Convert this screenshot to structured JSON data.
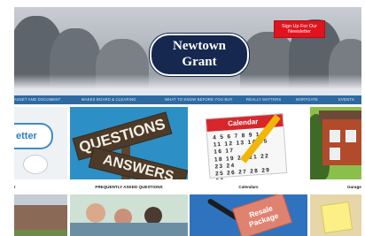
{
  "header": {
    "logo_line1": "Newtown",
    "logo_line2": "Grant",
    "signup_label": "Sign Up For Our Newsletter"
  },
  "nav": {
    "items": [
      "ASSET AND DOCUMENT",
      "MAKES BOARD & CLEARING",
      "WHAT TO KNOW BEFORE YOU BUY",
      "REALLY MATTERS",
      "MORTGATE",
      "EVENTS"
    ]
  },
  "tiles": [
    {
      "tile_text": "etter",
      "caption": "r"
    },
    {
      "sign1": "QUESTIONS",
      "sign2": "ANSWERS",
      "caption": "FREQUENTLY ASKED QUESTIONS"
    },
    {
      "cal_title": "Calendar",
      "cal_rows": [
        "4 5 6 7 8 9 10",
        "11 12 13 14 15 16 17",
        "18 19 20 21 22 23 24",
        "25 26 27 28 29 30"
      ],
      "caption": "Calendars"
    },
    {
      "caption": "Garage"
    }
  ],
  "row2": {
    "resale_line1": "Resale",
    "resale_line2": "Package"
  },
  "colors": {
    "nav_blue": "#2e6aa2",
    "logo_navy": "#16284f",
    "signup_red": "#e0141e"
  }
}
